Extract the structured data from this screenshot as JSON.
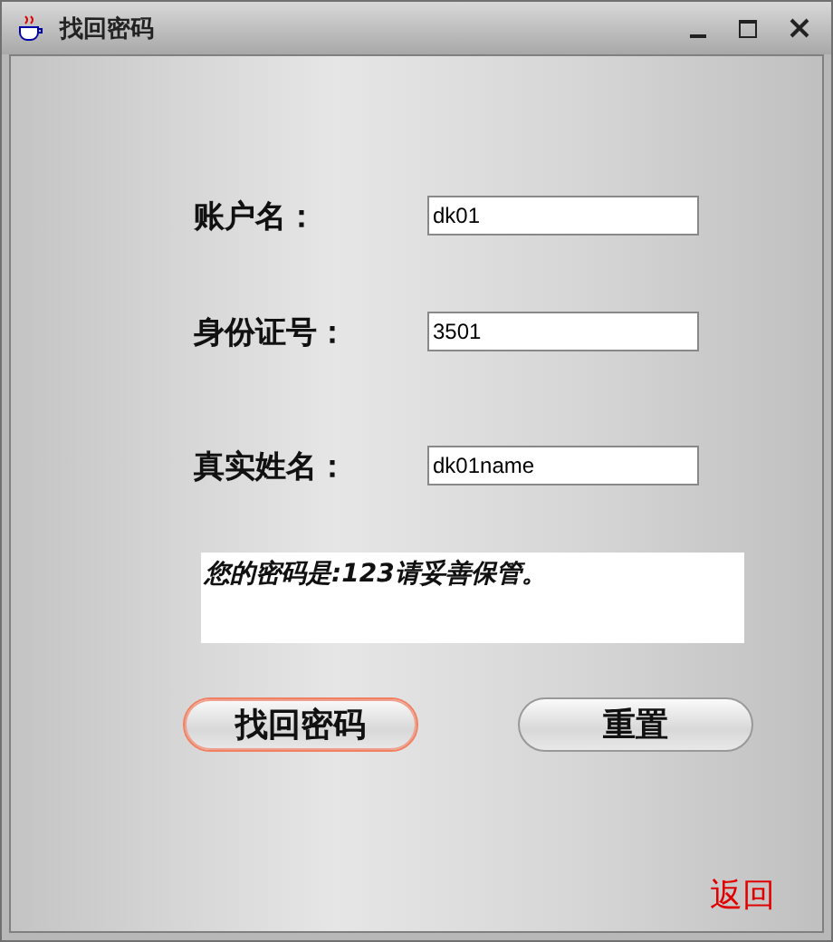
{
  "window": {
    "title": "找回密码"
  },
  "fields": [
    {
      "label": "账户名：",
      "value": "dk01"
    },
    {
      "label": "身份证号：",
      "value": "3501"
    },
    {
      "label": "真实姓名：",
      "value": "dk01name"
    }
  ],
  "message": "您的密码是:123请妥善保管。",
  "buttons": [
    {
      "label": "找回密码",
      "focused": true
    },
    {
      "label": "重置",
      "focused": false
    }
  ],
  "back_link": "返回"
}
